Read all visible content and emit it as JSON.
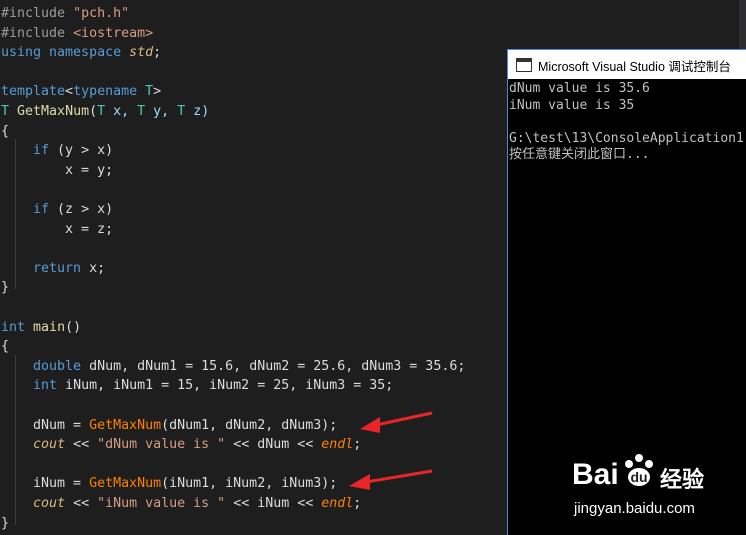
{
  "code": {
    "lines": [
      {
        "segments": [
          {
            "t": "#include ",
            "c": "pp"
          },
          {
            "t": "\"pch.h\"",
            "c": "str"
          }
        ]
      },
      {
        "segments": [
          {
            "t": "#include ",
            "c": "pp"
          },
          {
            "t": "<iostream>",
            "c": "str"
          }
        ]
      },
      {
        "segments": [
          {
            "t": "using",
            "c": "kw"
          },
          {
            "t": " namespace ",
            "c": "kw"
          },
          {
            "t": "std",
            "c": "ns"
          },
          {
            "t": ";",
            "c": ""
          }
        ]
      },
      {
        "segments": []
      },
      {
        "segments": [
          {
            "t": "template",
            "c": "kw"
          },
          {
            "t": "<",
            "c": ""
          },
          {
            "t": "typename",
            "c": "kw"
          },
          {
            "t": " T",
            "c": "tp"
          },
          {
            "t": ">",
            "c": ""
          }
        ]
      },
      {
        "segments": [
          {
            "t": "T",
            "c": "tp"
          },
          {
            "t": " ",
            "c": ""
          },
          {
            "t": "GetMaxNum",
            "c": "fn"
          },
          {
            "t": "(",
            "c": ""
          },
          {
            "t": "T",
            "c": "tp"
          },
          {
            "t": " x, ",
            "c": "var"
          },
          {
            "t": "T",
            "c": "tp"
          },
          {
            "t": " y, ",
            "c": "var"
          },
          {
            "t": "T",
            "c": "tp"
          },
          {
            "t": " z)",
            "c": "var"
          }
        ]
      },
      {
        "segments": [
          {
            "t": "{",
            "c": ""
          }
        ]
      },
      {
        "segments": [
          {
            "t": "    ",
            "c": ""
          },
          {
            "t": "if",
            "c": "kw"
          },
          {
            "t": " (y > x)",
            "c": ""
          }
        ]
      },
      {
        "segments": [
          {
            "t": "        x = y;",
            "c": ""
          }
        ]
      },
      {
        "segments": []
      },
      {
        "segments": [
          {
            "t": "    ",
            "c": ""
          },
          {
            "t": "if",
            "c": "kw"
          },
          {
            "t": " (z > x)",
            "c": ""
          }
        ]
      },
      {
        "segments": [
          {
            "t": "        x = z;",
            "c": ""
          }
        ]
      },
      {
        "segments": []
      },
      {
        "segments": [
          {
            "t": "    ",
            "c": ""
          },
          {
            "t": "return",
            "c": "kw"
          },
          {
            "t": " x;",
            "c": ""
          }
        ]
      },
      {
        "segments": [
          {
            "t": "}",
            "c": ""
          }
        ]
      },
      {
        "segments": []
      },
      {
        "segments": [
          {
            "t": "int",
            "c": "kw"
          },
          {
            "t": " ",
            "c": ""
          },
          {
            "t": "main",
            "c": "fn"
          },
          {
            "t": "()",
            "c": ""
          }
        ]
      },
      {
        "segments": [
          {
            "t": "{",
            "c": ""
          }
        ]
      },
      {
        "segments": [
          {
            "t": "    ",
            "c": ""
          },
          {
            "t": "double",
            "c": "kw"
          },
          {
            "t": " dNum, dNum1 = 15.6, dNum2 = 25.6, dNum3 = 35.6;",
            "c": ""
          }
        ]
      },
      {
        "segments": [
          {
            "t": "    ",
            "c": ""
          },
          {
            "t": "int",
            "c": "kw"
          },
          {
            "t": " iNum, iNum1 = 15, iNum2 = 25, iNum3 = 35;",
            "c": ""
          }
        ]
      },
      {
        "segments": []
      },
      {
        "segments": [
          {
            "t": "    dNum = ",
            "c": ""
          },
          {
            "t": "GetMaxNum",
            "c": "fn2"
          },
          {
            "t": "(dNum1, dNum2, dNum3);",
            "c": ""
          }
        ]
      },
      {
        "segments": [
          {
            "t": "    ",
            "c": ""
          },
          {
            "t": "cout",
            "c": "ital"
          },
          {
            "t": " << ",
            "c": ""
          },
          {
            "t": "\"dNum value is \"",
            "c": "str"
          },
          {
            "t": " << dNum << ",
            "c": ""
          },
          {
            "t": "endl",
            "c": "orange"
          },
          {
            "t": ";",
            "c": ""
          }
        ]
      },
      {
        "segments": []
      },
      {
        "segments": [
          {
            "t": "    iNum = ",
            "c": ""
          },
          {
            "t": "GetMaxNum",
            "c": "fn2"
          },
          {
            "t": "(iNum1, iNum2, iNum3);",
            "c": ""
          }
        ]
      },
      {
        "segments": [
          {
            "t": "    ",
            "c": ""
          },
          {
            "t": "cout",
            "c": "ital"
          },
          {
            "t": " << ",
            "c": ""
          },
          {
            "t": "\"iNum value is \"",
            "c": "str"
          },
          {
            "t": " << iNum << ",
            "c": ""
          },
          {
            "t": "endl",
            "c": "orange"
          },
          {
            "t": ";",
            "c": ""
          }
        ]
      },
      {
        "segments": [
          {
            "t": "}",
            "c": ""
          }
        ]
      }
    ]
  },
  "console": {
    "title": "Microsoft Visual Studio 调试控制台",
    "lines": [
      "dNum value is 35.6",
      "iNum value is 35",
      "",
      "G:\\test\\13\\ConsoleApplication1",
      "按任意键关闭此窗口..."
    ]
  },
  "watermark": {
    "brand": "Bai",
    "brand2": "经验",
    "url": "jingyan.baidu.com"
  },
  "colors": {
    "editor_bg": "#1e1e1e",
    "console_bg": "#000000",
    "arrow": "#e8262a"
  }
}
